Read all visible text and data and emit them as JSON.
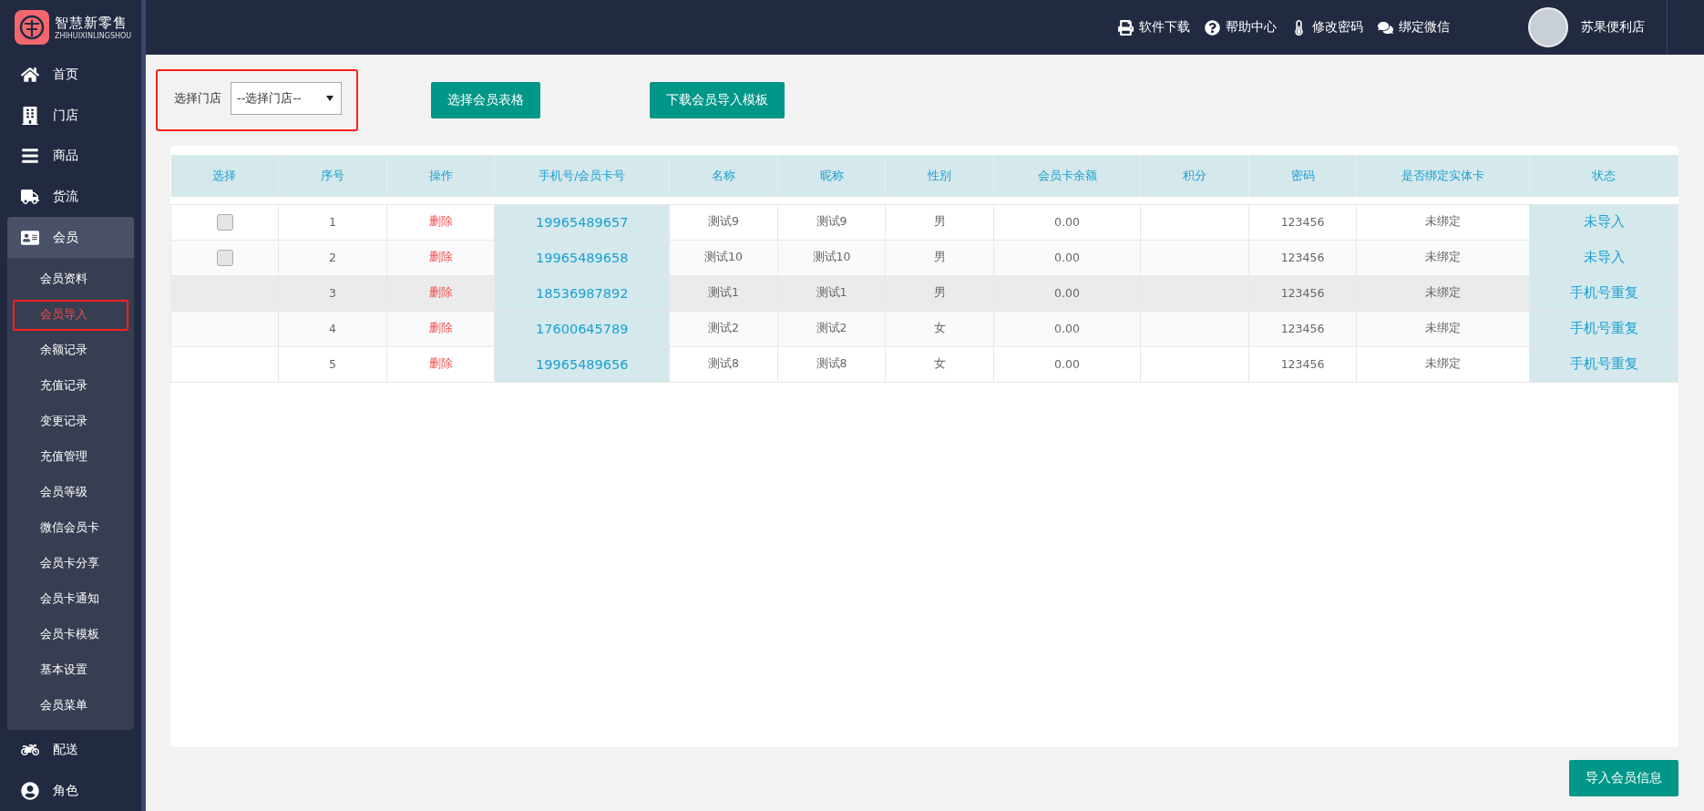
{
  "logo": {
    "title": "智慧新零售",
    "subtitle": "ZHIHUIXINLINGSHOU"
  },
  "sidebar": {
    "items": [
      {
        "kind": "home",
        "label": "首页",
        "expanded": false
      },
      {
        "kind": "store",
        "label": "门店",
        "expanded": false
      },
      {
        "kind": "goods",
        "label": "商品",
        "expanded": false
      },
      {
        "kind": "logistics",
        "label": "货流",
        "expanded": false
      },
      {
        "kind": "member",
        "label": "会员",
        "expanded": true,
        "children": [
          {
            "label": "会员资料",
            "selected": false,
            "annotated": false
          },
          {
            "label": "会员导入",
            "selected": true,
            "annotated": true
          },
          {
            "label": "余额记录",
            "selected": false,
            "annotated": false
          },
          {
            "label": "充值记录",
            "selected": false,
            "annotated": false
          },
          {
            "label": "变更记录",
            "selected": false,
            "annotated": false
          },
          {
            "label": "充值管理",
            "selected": false,
            "annotated": false
          },
          {
            "label": "会员等级",
            "selected": false,
            "annotated": false
          },
          {
            "label": "微信会员卡",
            "selected": false,
            "annotated": false
          },
          {
            "label": "会员卡分享",
            "selected": false,
            "annotated": false
          },
          {
            "label": "会员卡通知",
            "selected": false,
            "annotated": false
          },
          {
            "label": "会员卡模板",
            "selected": false,
            "annotated": false
          },
          {
            "label": "基本设置",
            "selected": false,
            "annotated": false
          },
          {
            "label": "会员菜单",
            "selected": false,
            "annotated": false
          }
        ]
      },
      {
        "kind": "delivery",
        "label": "配送",
        "expanded": false
      },
      {
        "kind": "role",
        "label": "角色",
        "expanded": false
      }
    ]
  },
  "topbar": {
    "links": [
      {
        "kind": "download",
        "label": "软件下载"
      },
      {
        "kind": "help",
        "label": "帮助中心"
      },
      {
        "kind": "password",
        "label": "修改密码"
      },
      {
        "kind": "wechat",
        "label": "绑定微信"
      }
    ],
    "user": "苏果便利店"
  },
  "toolbar": {
    "store_label": "选择门店",
    "store_select": {
      "value": "--选择门店--",
      "annotated": true
    },
    "buttons": [
      "选择会员表格",
      "下载会员导入模板"
    ]
  },
  "table": {
    "columns": [
      "选择",
      "序号",
      "操作",
      "手机号/会员卡号",
      "名称",
      "昵称",
      "性别",
      "会员卡余额",
      "积分",
      "密码",
      "是否绑定实体卡",
      "状态"
    ],
    "rows": [
      {
        "checkbox": {
          "checked": false
        },
        "highlighted": false,
        "cells": [
          "",
          "1",
          "删除",
          "19965489657",
          "测试9",
          "测试9",
          "男",
          "0.00",
          "",
          "123456",
          "未绑定",
          "未导入"
        ]
      },
      {
        "checkbox": {
          "checked": false
        },
        "highlighted": false,
        "cells": [
          "",
          "2",
          "删除",
          "19965489658",
          "测试10",
          "测试10",
          "男",
          "0.00",
          "",
          "123456",
          "未绑定",
          "未导入"
        ]
      },
      {
        "highlighted": true,
        "cells": [
          "",
          "3",
          "删除",
          "18536987892",
          "测试1",
          "测试1",
          "男",
          "0.00",
          "",
          "123456",
          "未绑定",
          "手机号重复"
        ]
      },
      {
        "highlighted": false,
        "cells": [
          "",
          "4",
          "删除",
          "17600645789",
          "测试2",
          "测试2",
          "女",
          "0.00",
          "",
          "123456",
          "未绑定",
          "手机号重复"
        ]
      },
      {
        "highlighted": false,
        "cells": [
          "",
          "5",
          "删除",
          "19965489656",
          "测试8",
          "测试8",
          "女",
          "0.00",
          "",
          "123456",
          "未绑定",
          "手机号重复"
        ]
      }
    ]
  },
  "footer_button": "导入会员信息"
}
